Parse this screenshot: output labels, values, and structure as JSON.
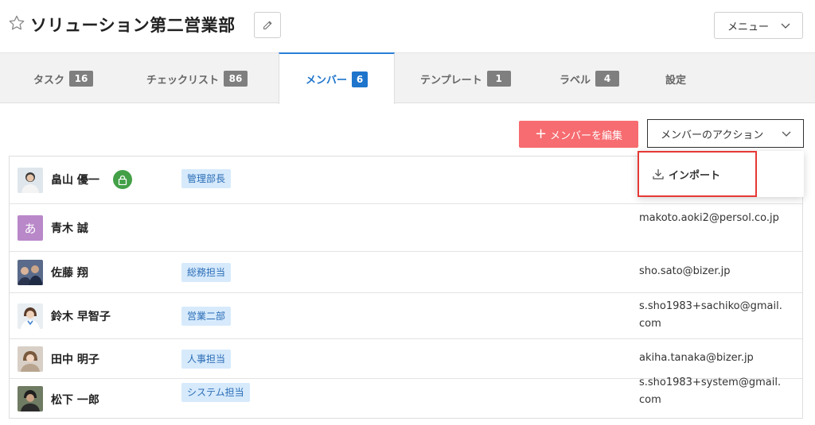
{
  "header": {
    "title": "ソリューション第二営業部",
    "menu_label": "メニュー"
  },
  "tabs": [
    {
      "label": "タスク",
      "count": "16"
    },
    {
      "label": "チェックリスト",
      "count": "86"
    },
    {
      "label": "メンバー",
      "count": "6"
    },
    {
      "label": "テンプレート",
      "count": "1"
    },
    {
      "label": "ラベル",
      "count": "4"
    },
    {
      "label": "設定"
    }
  ],
  "actions": {
    "edit_members_label": "メンバーを編集",
    "member_actions_label": "メンバーのアクション"
  },
  "dropdown": {
    "import_label": "インポート"
  },
  "members": [
    {
      "name": "畠山 優一",
      "role": "管理部長",
      "email": ""
    },
    {
      "name": "青木 誠",
      "avatar_letter": "あ",
      "role": "",
      "email": "makoto.aoki2@persol.co.jp"
    },
    {
      "name": "佐藤 翔",
      "role": "総務担当",
      "email": "sho.sato@bizer.jp"
    },
    {
      "name": "鈴木 早智子",
      "role": "営業二部",
      "email": "s.sho1983+sachiko@gmail.com"
    },
    {
      "name": "田中 明子",
      "role": "人事担当",
      "email": "akiha.tanaka@bizer.jp"
    },
    {
      "name": "松下 一郎",
      "role": "システム担当",
      "email": "s.sho1983+system@gmail.com"
    }
  ],
  "colors": {
    "accent": "#1f75cc",
    "primary_button": "#f66c70",
    "role_badge_bg": "#d6eafc",
    "highlight_border": "#e53935",
    "lock_green": "#43a047"
  }
}
